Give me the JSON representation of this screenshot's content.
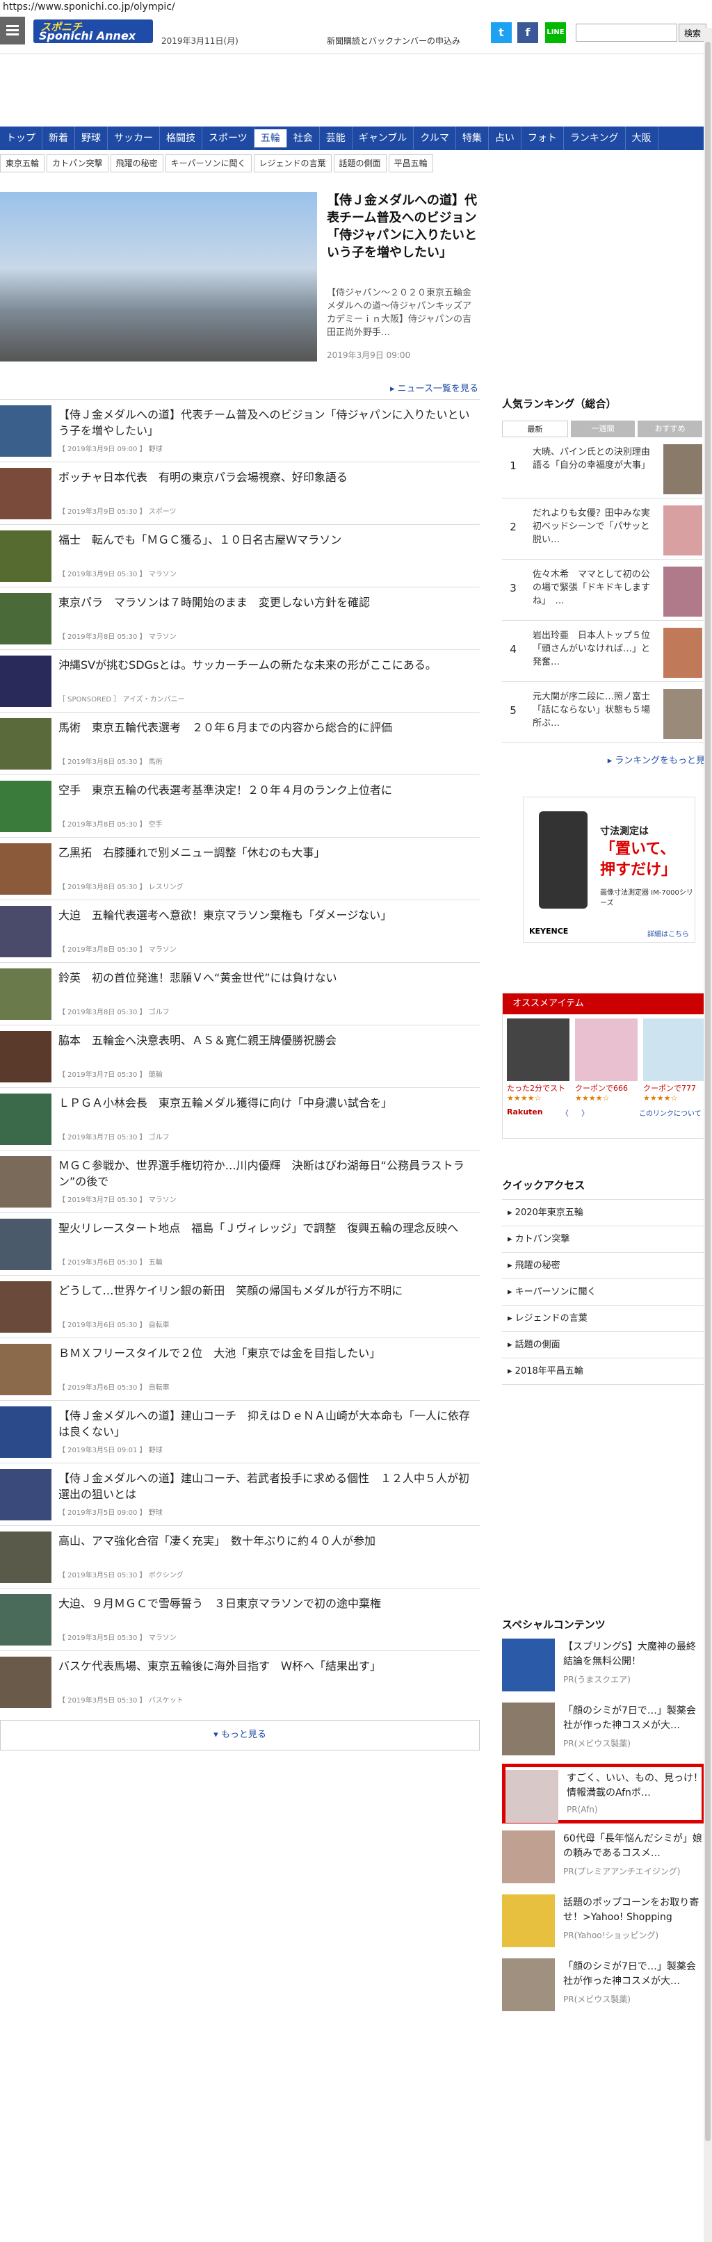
{
  "url": "https://www.sponichi.co.jp/olympic/",
  "header": {
    "logo_top": "スポニチ",
    "logo_bottom": "Sponichi Annex",
    "date": "2019年3月11日(月)",
    "subscribe": "新聞購読とバックナンバーの申込み",
    "search_placeholder": "",
    "search_button": "検索"
  },
  "nav": [
    "トップ",
    "新着",
    "野球",
    "サッカー",
    "格闘技",
    "スポーツ",
    "五輪",
    "社会",
    "芸能",
    "ギャンブル",
    "クルマ",
    "特集",
    "占い",
    "フォト",
    "ランキング",
    "大阪"
  ],
  "nav_active": "五輪",
  "subnav": [
    "東京五輪",
    "カトパン突撃",
    "飛躍の秘密",
    "キーパーソンに聞く",
    "レジェンドの言葉",
    "話題の側面",
    "平昌五輪"
  ],
  "hero": {
    "title": "【侍Ｊ金メダルへの道】代表チーム普及へのビジョン「侍ジャパンに入りたいという子を増やしたい」",
    "summary": "【侍ジャパン～２０２０東京五輪金メダルへの道～侍ジャパンキッズアカデミーｉｎ大阪】侍ジャパンの吉田正尚外野手…",
    "date": "2019年3月9日 09:00"
  },
  "news_list_link": "ニュース一覧を見る",
  "news": [
    {
      "title": "【侍Ｊ金メダルへの道】代表チーム普及へのビジョン「侍ジャパンに入りたいという子を増やしたい」",
      "meta": "【 2019年3月9日 09:00 】 野球"
    },
    {
      "title": "ボッチャ日本代表　有明の東京パラ会場視察、好印象語る",
      "meta": "【 2019年3月9日 05:30 】 スポーツ"
    },
    {
      "title": "福士　転んでも「ＭＧＣ獲る」、１０日名古屋Ｗマラソン",
      "meta": "【 2019年3月9日 05:30 】 マラソン"
    },
    {
      "title": "東京パラ　マラソンは７時開始のまま　変更しない方針を確認",
      "meta": "【 2019年3月8日 05:30 】 マラソン"
    },
    {
      "title": "沖縄SVが挑むSDGsとは。サッカーチームの新たな未来の形がここにある。",
      "meta": "［ SPONSORED ］ アイズ・カンパニー"
    },
    {
      "title": "馬術　東京五輪代表選考　２０年６月までの内容から総合的に評価",
      "meta": "【 2019年3月8日 05:30 】 馬術"
    },
    {
      "title": "空手　東京五輪の代表選考基準決定！２０年４月のランク上位者に",
      "meta": "【 2019年3月8日 05:30 】 空手"
    },
    {
      "title": "乙黒拓　右膝腫れで別メニュー調整「休むのも大事」",
      "meta": "【 2019年3月8日 05:30 】 レスリング"
    },
    {
      "title": "大迫　五輪代表選考へ意欲！東京マラソン棄権も「ダメージない」",
      "meta": "【 2019年3月8日 05:30 】 マラソン"
    },
    {
      "title": "鈴英　初の首位発進！悲願Ｖへ“黄金世代”には負けない",
      "meta": "【 2019年3月8日 05:30 】 ゴルフ"
    },
    {
      "title": "脇本　五輪金へ決意表明、ＡＳ＆寛仁親王牌優勝祝勝会",
      "meta": "【 2019年3月7日 05:30 】 競輪"
    },
    {
      "title": "ＬＰＧＡ小林会長　東京五輪メダル獲得に向け「中身濃い試合を」",
      "meta": "【 2019年3月7日 05:30 】 ゴルフ"
    },
    {
      "title": "ＭＧＣ参戦か、世界選手権切符か…川内優輝　決断はびわ湖毎日“公務員ラストラン”の後で",
      "meta": "【 2019年3月7日 05:30 】 マラソン"
    },
    {
      "title": "聖火リレースタート地点　福島「Ｊヴィレッジ」で調整　復興五輪の理念反映へ",
      "meta": "【 2019年3月6日 05:30 】 五輪"
    },
    {
      "title": "どうして…世界ケイリン銀の新田　笑顔の帰国もメダルが行方不明に",
      "meta": "【 2019年3月6日 05:30 】 自転車"
    },
    {
      "title": "ＢＭＸフリースタイルで２位　大池「東京では金を目指したい」",
      "meta": "【 2019年3月6日 05:30 】 自転車"
    },
    {
      "title": "【侍Ｊ金メダルへの道】建山コーチ　抑えはＤｅＮＡ山崎が大本命も「一人に依存は良くない」",
      "meta": "【 2019年3月5日 09:01 】 野球"
    },
    {
      "title": "【侍Ｊ金メダルへの道】建山コーチ、若武者投手に求める個性　１２人中５人が初選出の狙いとは",
      "meta": "【 2019年3月5日 09:00 】 野球"
    },
    {
      "title": "高山、アマ強化合宿「凄く充実」　数十年ぶりに約４０人が参加",
      "meta": "【 2019年3月5日 05:30 】 ボクシング"
    },
    {
      "title": "大迫、９月ＭＧＣで雪辱誓う　３日東京マラソンで初の途中棄権",
      "meta": "【 2019年3月5日 05:30 】 マラソン"
    },
    {
      "title": "バスケ代表馬場、東京五輪後に海外目指す　Ｗ杯へ「結果出す」",
      "meta": "【 2019年3月5日 05:30 】 バスケット"
    }
  ],
  "more_button": "もっと見る",
  "ranking": {
    "title": "人気ランキング（総合）",
    "tabs": [
      "最新",
      "一週間",
      "おすすめ"
    ],
    "items": [
      {
        "n": "1",
        "title": "大暁、パイン氏との決別理由語る「自分の幸福度が大事」"
      },
      {
        "n": "2",
        "title": "だれよりも女優？田中みな実　初ベッドシーンで「パサッと脱い…"
      },
      {
        "n": "3",
        "title": "佐々木希　ママとして初の公の場で緊張「ドキドキしますね」　…"
      },
      {
        "n": "4",
        "title": "岩出玲亜　日本人トップ５位「頭さんがいなければ…」と発奮…"
      },
      {
        "n": "5",
        "title": "元大関が序二段に…照ノ富士「話にならない」状態も５場所ぶ…"
      }
    ],
    "more": "ランキングをもっと見"
  },
  "ad1": {
    "l1": "寸法測定は",
    "l2": "「置いて、",
    "l3": "押すだけ」",
    "l4": "画像寸法測定器 IM-7000シリーズ",
    "brand": "KEYENCE",
    "detail": "詳細はこちら"
  },
  "ad2": {
    "bar": "オススメアイテム",
    "cells": [
      {
        "label": "たった2分でスト",
        "stars": "★★★★☆"
      },
      {
        "label": "クーポンで666",
        "stars": "★★★★☆"
      },
      {
        "label": "クーポンで777",
        "stars": "★★★★☆"
      }
    ],
    "brand": "Rakuten",
    "pager": "〈 　 〉",
    "other": "このリンクについて"
  },
  "quick": {
    "title": "クイックアクセス",
    "items": [
      "2020年東京五輪",
      "カトパン突撃",
      "飛躍の秘密",
      "キーパーソンに聞く",
      "レジェンドの言葉",
      "話題の側面",
      "2018年平昌五輪"
    ]
  },
  "special": {
    "title": "スペシャルコンテンツ",
    "items": [
      {
        "title": "【スプリングS】大魔神の最終結論を無料公開！",
        "pr": "PR(うまスクエア)"
      },
      {
        "title": "「顔のシミが7日で…」製薬会社が作った神コスメが大…",
        "pr": "PR(メビウス製薬)"
      },
      {
        "title": "すごく、いい、もの、見っけ！情報満載のAfnボ…",
        "pr": "PR(Afn)"
      },
      {
        "title": "60代母「長年悩んだシミが」娘の頼みであるコスメ…",
        "pr": "PR(プレミアアンチエイジング)"
      },
      {
        "title": "話題のポップコーンをお取り寄せ！>Yahoo! Shopping",
        "pr": "PR(Yahoo!ショッピング)"
      },
      {
        "title": "「顔のシミが7日で…」製薬会社が作った神コスメが大…",
        "pr": "PR(メビウス製薬)"
      }
    ]
  }
}
